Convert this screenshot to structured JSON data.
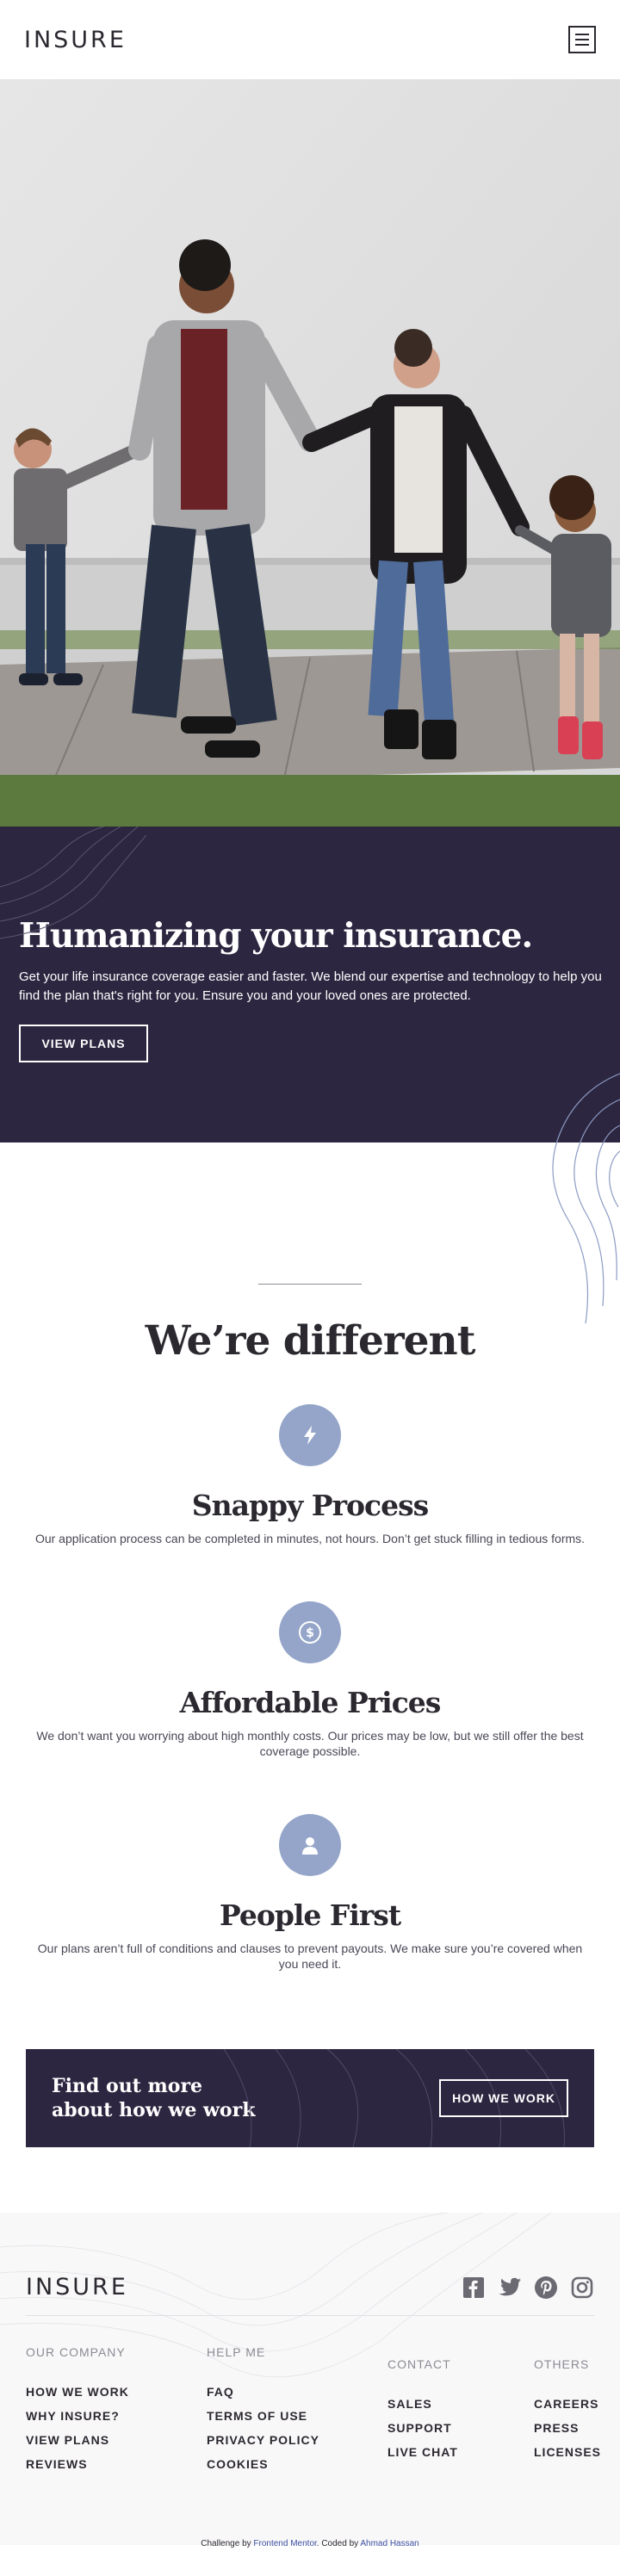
{
  "header": {
    "logo": "INSURE",
    "menu_icon": "hamburger-icon"
  },
  "hero": {
    "title": "Humanizing your insurance.",
    "subtitle": "Get your life insurance coverage easier and faster. We blend our expertise and technology to help you find the plan that's right for you. Ensure you and your loved ones are protected.",
    "button": "VIEW PLANS"
  },
  "different": {
    "title": "We’re different",
    "features": [
      {
        "icon": "lightning-icon",
        "title": "Snappy Process",
        "desc": "Our application process can be completed in minutes, not hours. Don’t get stuck filling in tedious forms."
      },
      {
        "icon": "dollar-icon",
        "title": "Affordable Prices",
        "desc": "We don’t want you worrying about high monthly costs. Our prices may be low, but we still offer the best coverage possible."
      },
      {
        "icon": "person-icon",
        "title": "People First",
        "desc": "Our plans aren’t full of conditions and clauses to prevent payouts. We make sure you’re covered when you need it."
      }
    ]
  },
  "cta": {
    "title_line1": "Find out more",
    "title_line2": "about how we work",
    "button": "HOW WE WORK"
  },
  "footer": {
    "logo": "INSURE",
    "socials": [
      "facebook-icon",
      "twitter-icon",
      "pinterest-icon",
      "instagram-icon"
    ],
    "columns": [
      {
        "heading": "OUR COMPANY",
        "links": [
          "HOW WE WORK",
          "WHY INSURE?",
          "VIEW PLANS",
          "REVIEWS"
        ]
      },
      {
        "heading": "HELP ME",
        "links": [
          "FAQ",
          "TERMS OF USE",
          "PRIVACY POLICY",
          "COOKIES"
        ]
      },
      {
        "heading": "CONTACT",
        "links": [
          "SALES",
          "SUPPORT",
          "LIVE CHAT"
        ]
      },
      {
        "heading": "OTHERS",
        "links": [
          "CAREERS",
          "PRESS",
          "LICENSES"
        ]
      }
    ]
  },
  "attribution": {
    "prefix": "Challenge by ",
    "link1": "Frontend Mentor",
    "middle": ". Coded by ",
    "link2": "Ahmad Hassan"
  },
  "colors": {
    "dark_violet": "#2c2640",
    "accent_blue": "#94a5c9",
    "text_dark": "#2c2830"
  }
}
